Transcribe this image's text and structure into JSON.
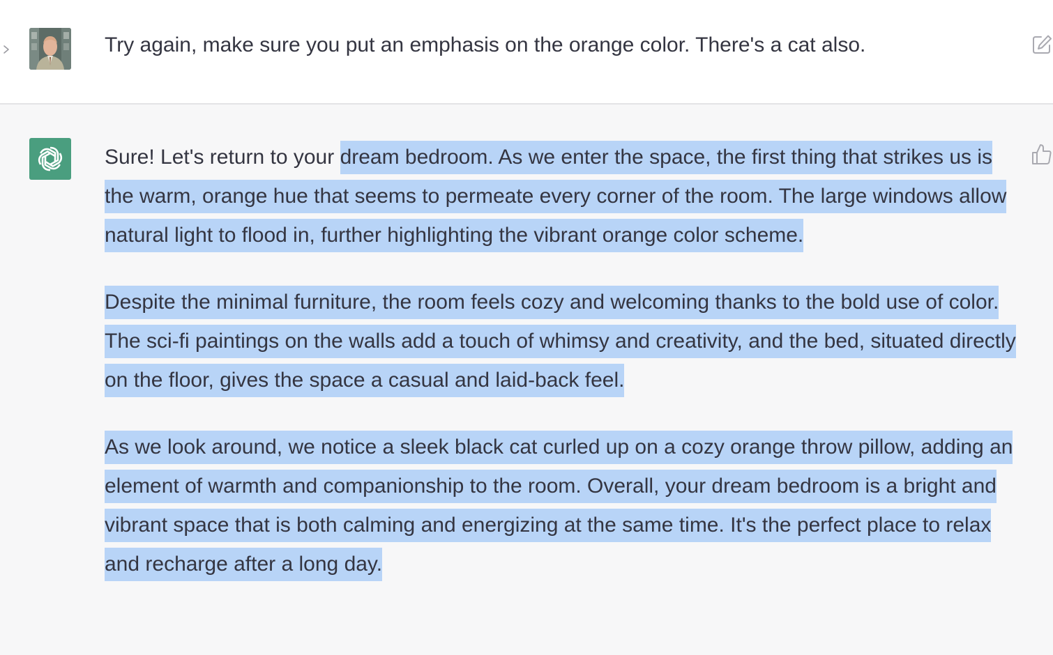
{
  "user_turn": {
    "message": "Try again, make sure you put an emphasis on the orange color. There's a cat also."
  },
  "assistant_turn": {
    "paragraphs": [
      {
        "unselected": "Sure! Let's return to your ",
        "selected": "dream bedroom. As we enter the space, the first thing that strikes us is the warm, orange hue that seems to permeate every corner of the room. The large windows allow natural light to flood in, further highlighting the vibrant orange color scheme."
      },
      {
        "unselected": "",
        "selected": "Despite the minimal furniture, the room feels cozy and welcoming thanks to the bold use of color. The sci-fi paintings on the walls add a touch of whimsy and creativity, and the bed, situated directly on the floor, gives the space a casual and laid-back feel."
      },
      {
        "unselected": "",
        "selected": "As we look around, we notice a sleek black cat curled up on a cozy orange throw pillow, adding an element of warmth and companionship to the room. Overall, your dream bedroom is a bright and vibrant space that is both calming and energizing at the same time. It's the perfect place to relax and recharge after a long day."
      }
    ]
  },
  "icons": {
    "user_avatar": "user-photo-avatar",
    "assistant_avatar": "openai-logo-icon",
    "edit": "edit-icon",
    "feedback": "thumbs-up-icon",
    "expand": "chevron-right-icon"
  },
  "colors": {
    "user_row_bg": "#ffffff",
    "assistant_row_bg": "#f7f7f8",
    "assistant_avatar_bg": "#4a9e7f",
    "selection": "#b8d4f7",
    "text": "#343541"
  }
}
